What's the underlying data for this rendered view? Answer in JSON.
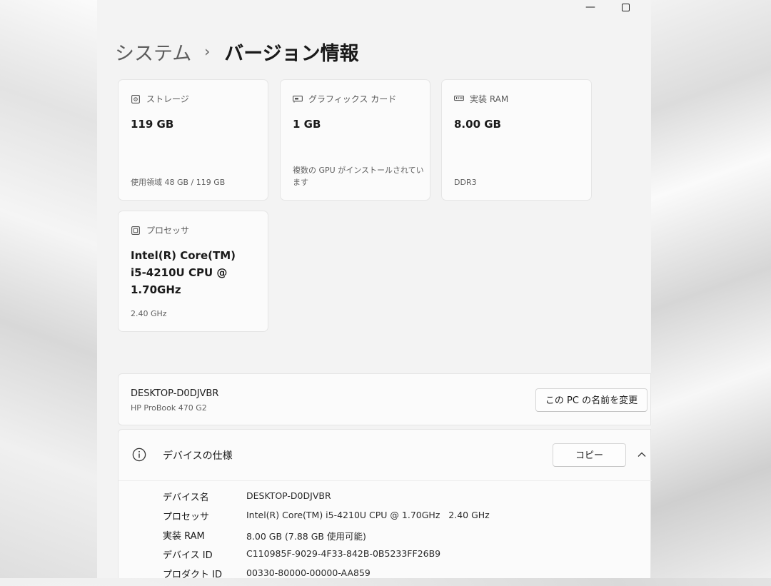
{
  "window": {
    "minimize_glyph": "—",
    "breadcrumb": {
      "parent": "システム",
      "separator": "›",
      "current": "バージョン情報"
    }
  },
  "cards": [
    {
      "icon": "storage-icon",
      "title": "ストレージ",
      "value": "119 GB",
      "sub": "使用領域 48 GB / 119 GB"
    },
    {
      "icon": "graphics-card-icon",
      "title": "グラフィックス カード",
      "value": "1 GB",
      "sub": "複数の GPU がインストールされています"
    },
    {
      "icon": "ram-icon",
      "title": "実装 RAM",
      "value": "8.00 GB",
      "sub": "DDR3"
    },
    {
      "icon": "processor-icon",
      "title": "プロセッサ",
      "value": "Intel(R) Core(TM) i5-4210U CPU @ 1.70GHz",
      "sub": "2.40 GHz"
    }
  ],
  "device": {
    "name": "DESKTOP-D0DJVBR",
    "model": "HP ProBook 470 G2",
    "rename_label": "この PC の名前を変更"
  },
  "specs": {
    "title": "デバイスの仕様",
    "copy_label": "コピー",
    "rows": [
      {
        "label": "デバイス名",
        "value": "DESKTOP-D0DJVBR"
      },
      {
        "label": "プロセッサ",
        "value": "Intel(R) Core(TM) i5-4210U CPU @ 1.70GHz   2.40 GHz"
      },
      {
        "label": "実装 RAM",
        "value": "8.00 GB (7.88 GB 使用可能)"
      },
      {
        "label": "デバイス ID",
        "value": "C110985F-9029-4F33-842B-0B5233FF26B9"
      },
      {
        "label": "プロダクト ID",
        "value": "00330-80000-00000-AA859"
      }
    ]
  }
}
